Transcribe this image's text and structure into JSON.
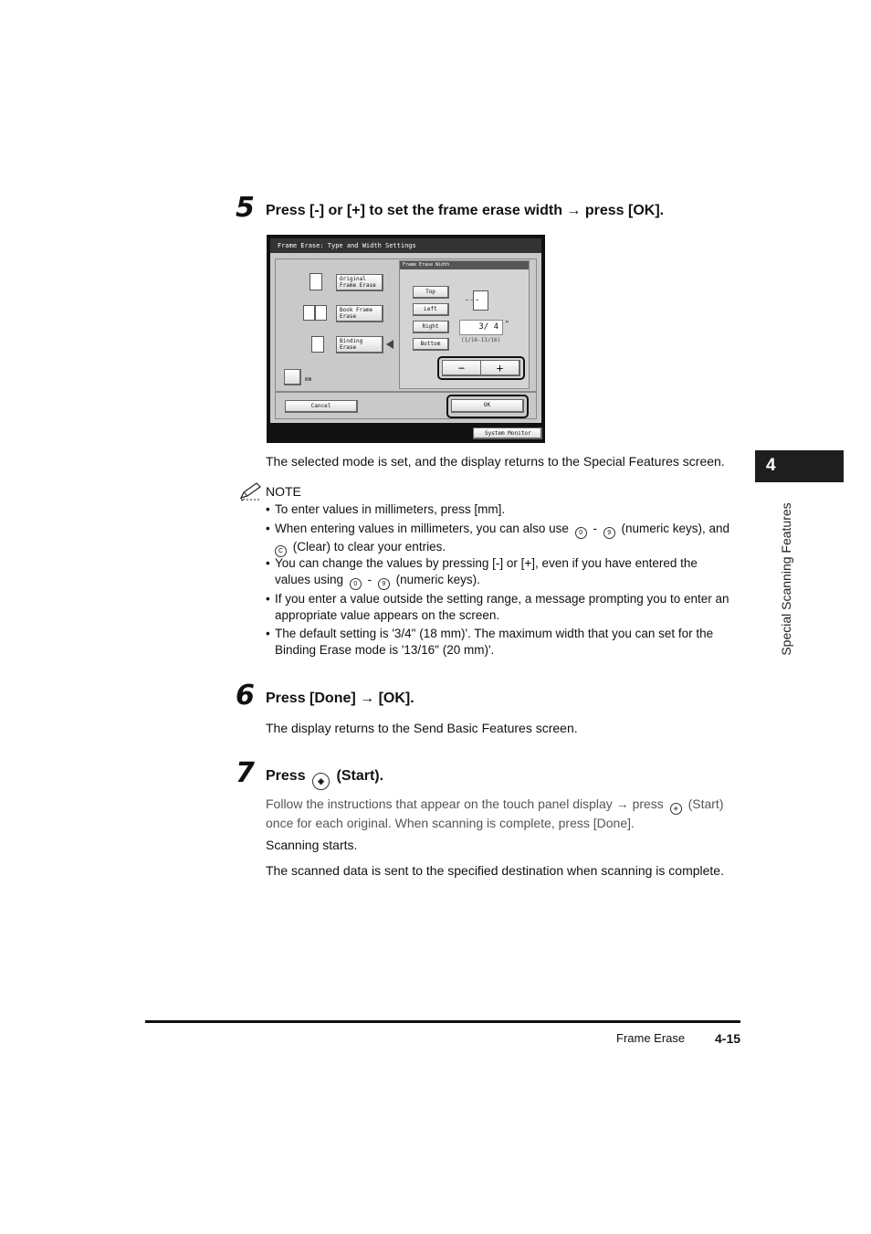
{
  "chapter_tab": "4",
  "side_label": "Special Scanning Features",
  "step5": {
    "number": "5",
    "title": "Press [-] or [+] to set the frame erase width → press [OK].",
    "result": "The selected mode is set, and the display returns to the Special Features screen."
  },
  "screen": {
    "title": "Frame Erase: Type and Width Settings",
    "original_frame_erase": "Original\nFrame Erase",
    "book_frame_erase": "Book Frame\nErase",
    "binding_erase": "Binding\nErase",
    "mm_label": "mm",
    "width_title": "Frame Erase Width",
    "top": "Top",
    "left": "Left",
    "right": "Right",
    "bottom": "Bottom",
    "value": "3/ 4",
    "unit": "\"",
    "range": "(1/16-13/16)",
    "minus": "−",
    "plus": "+",
    "cancel": "Cancel",
    "ok": "OK",
    "system_monitor": "System Monitor"
  },
  "note": {
    "label": "NOTE",
    "b1": "To enter values in millimeters, press [mm].",
    "b2_a": "When entering values in millimeters, you can also use",
    "b2_dash": "-",
    "b2_b": "(numeric keys), and",
    "b2_c": "(Clear) to clear your entries.",
    "b3_a": "You can change the values by pressing [-] or [+], even if you have entered the",
    "b3_b": "values using",
    "b3_dash": "-",
    "b3_c": "(numeric keys).",
    "b4_a": "If you enter a value outside the setting range, a message prompting you to enter an",
    "b4_b": "appropriate value appears on the screen.",
    "b5_a": "The default setting is '3/4\" (18 mm)'. The maximum width that you can set for the",
    "b5_b": "Binding Erase mode is '13/16\" (20 mm)'.",
    "key_0": "0",
    "key_9": "9",
    "key_c": "C"
  },
  "step6": {
    "number": "6",
    "title": "Press [Done] → [OK].",
    "result": "The display returns to the Send Basic Features screen."
  },
  "step7": {
    "number": "7",
    "title_a": "Press",
    "title_b": "(Start).",
    "line1_a": "Follow the instructions that appear on the touch panel display → press",
    "line1_b": "(Start)",
    "line2": "once for each original. When scanning is complete, press [Done].",
    "p2": "Scanning starts.",
    "p3": "The scanned data is sent to the specified destination when scanning is complete."
  },
  "footer": {
    "section": "Frame Erase",
    "page": "4-15"
  }
}
